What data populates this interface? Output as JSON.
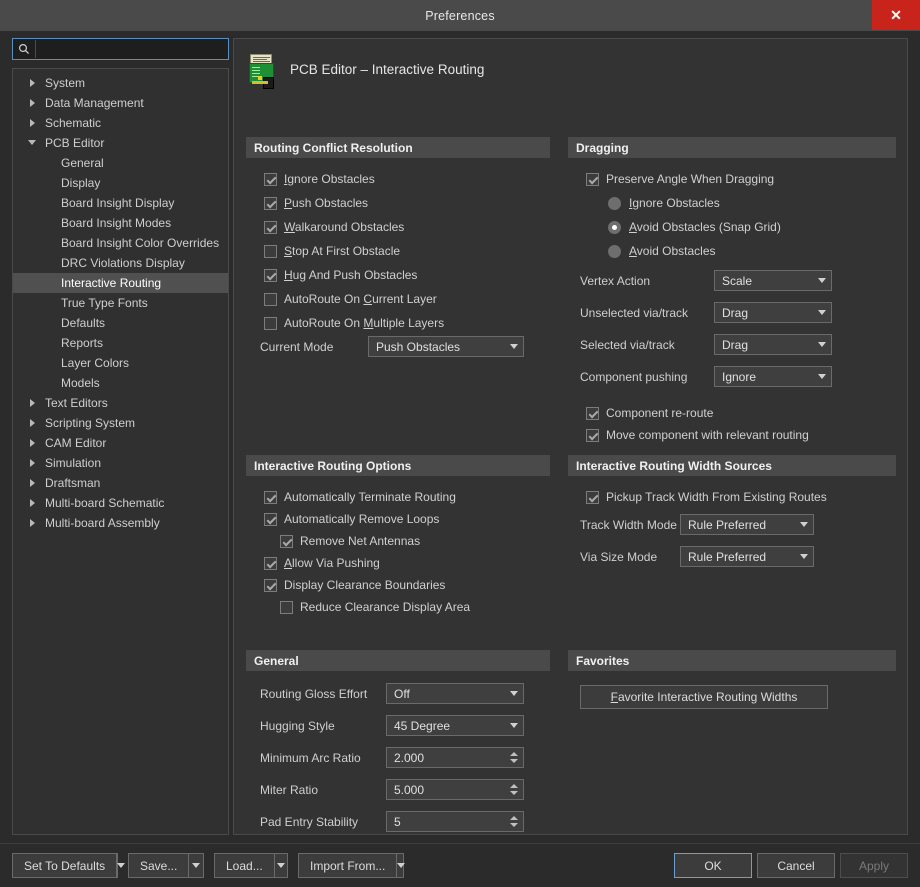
{
  "window": {
    "title": "Preferences",
    "close_icon": "close-icon"
  },
  "search": {
    "placeholder": "",
    "value": "",
    "icon": "search-icon"
  },
  "sidebar": {
    "items": [
      {
        "label": "System",
        "level": 0,
        "state": "collapsed",
        "selected": false
      },
      {
        "label": "Data Management",
        "level": 0,
        "state": "collapsed",
        "selected": false
      },
      {
        "label": "Schematic",
        "level": 0,
        "state": "collapsed",
        "selected": false
      },
      {
        "label": "PCB Editor",
        "level": 0,
        "state": "expanded",
        "selected": false
      },
      {
        "label": "General",
        "level": 1,
        "state": "leaf",
        "selected": false
      },
      {
        "label": "Display",
        "level": 1,
        "state": "leaf",
        "selected": false
      },
      {
        "label": "Board Insight Display",
        "level": 1,
        "state": "leaf",
        "selected": false
      },
      {
        "label": "Board Insight Modes",
        "level": 1,
        "state": "leaf",
        "selected": false
      },
      {
        "label": "Board Insight Color Overrides",
        "level": 1,
        "state": "leaf",
        "selected": false
      },
      {
        "label": "DRC Violations Display",
        "level": 1,
        "state": "leaf",
        "selected": false
      },
      {
        "label": "Interactive Routing",
        "level": 1,
        "state": "leaf",
        "selected": true
      },
      {
        "label": "True Type Fonts",
        "level": 1,
        "state": "leaf",
        "selected": false
      },
      {
        "label": "Defaults",
        "level": 1,
        "state": "leaf",
        "selected": false
      },
      {
        "label": "Reports",
        "level": 1,
        "state": "leaf",
        "selected": false
      },
      {
        "label": "Layer Colors",
        "level": 1,
        "state": "leaf",
        "selected": false
      },
      {
        "label": "Models",
        "level": 1,
        "state": "leaf",
        "selected": false
      },
      {
        "label": "Text Editors",
        "level": 0,
        "state": "collapsed",
        "selected": false
      },
      {
        "label": "Scripting System",
        "level": 0,
        "state": "collapsed",
        "selected": false
      },
      {
        "label": "CAM Editor",
        "level": 0,
        "state": "collapsed",
        "selected": false
      },
      {
        "label": "Simulation",
        "level": 0,
        "state": "collapsed",
        "selected": false
      },
      {
        "label": "Draftsman",
        "level": 0,
        "state": "collapsed",
        "selected": false
      },
      {
        "label": "Multi-board Schematic",
        "level": 0,
        "state": "collapsed",
        "selected": false
      },
      {
        "label": "Multi-board Assembly",
        "level": 0,
        "state": "collapsed",
        "selected": false
      }
    ]
  },
  "page": {
    "icon": "pcb-board-icon",
    "title": "PCB Editor – Interactive Routing"
  },
  "routing_conflict_resolution": {
    "header": "Routing Conflict Resolution",
    "checkboxes": [
      {
        "label": "Ignore Obstacles",
        "accel": "I",
        "checked": true
      },
      {
        "label": "Push Obstacles",
        "accel": "P",
        "checked": true
      },
      {
        "label": "Walkaround Obstacles",
        "accel": "W",
        "checked": true
      },
      {
        "label": "Stop At First Obstacle",
        "accel": "S",
        "checked": false
      },
      {
        "label": "Hug And Push Obstacles",
        "accel": "H",
        "checked": true
      },
      {
        "label": "AutoRoute On Current Layer",
        "accel": "C",
        "checked": false
      },
      {
        "label": "AutoRoute On Multiple Layers",
        "accel": "M",
        "checked": false
      }
    ],
    "current_mode": {
      "label": "Current Mode",
      "value": "Push Obstacles"
    }
  },
  "interactive_routing_options": {
    "header": "Interactive Routing Options",
    "checkboxes": [
      {
        "label": "Automatically Terminate Routing",
        "accel": "",
        "checked": true,
        "indent": 0
      },
      {
        "label": "Automatically Remove Loops",
        "accel": "",
        "checked": true,
        "indent": 0
      },
      {
        "label": "Remove Net Antennas",
        "accel": "",
        "checked": true,
        "indent": 1
      },
      {
        "label": "Allow Via Pushing",
        "accel": "A",
        "checked": true,
        "indent": 0
      },
      {
        "label": "Display Clearance Boundaries",
        "accel": "",
        "checked": true,
        "indent": 0
      },
      {
        "label": "Reduce Clearance Display Area",
        "accel": "",
        "checked": false,
        "indent": 1
      }
    ]
  },
  "general": {
    "header": "General",
    "fields": [
      {
        "label": "Routing Gloss Effort",
        "value": "Off",
        "type": "combo"
      },
      {
        "label": "Hugging Style",
        "value": "45 Degree",
        "type": "combo"
      },
      {
        "label": "Minimum Arc Ratio",
        "value": "2.000",
        "type": "spin"
      },
      {
        "label": "Miter Ratio",
        "value": "5.000",
        "type": "spin"
      },
      {
        "label": "Pad Entry Stability",
        "value": "5",
        "type": "spin"
      }
    ]
  },
  "dragging": {
    "header": "Dragging",
    "preserve_angle": {
      "label": "Preserve Angle When Dragging",
      "checked": true
    },
    "radios": [
      {
        "label": "Ignore Obstacles",
        "accel": "I",
        "selected": false
      },
      {
        "label": "Avoid Obstacles (Snap Grid)",
        "accel": "A",
        "selected": true
      },
      {
        "label": "Avoid Obstacles",
        "accel": "A",
        "selected": false
      }
    ],
    "fields": [
      {
        "label": "Vertex Action",
        "value": "Scale"
      },
      {
        "label": "Unselected via/track",
        "value": "Drag"
      },
      {
        "label": "Selected via/track",
        "value": "Drag"
      },
      {
        "label": "Component pushing",
        "value": "Ignore"
      }
    ],
    "checkboxes": [
      {
        "label": "Component re-route",
        "checked": true
      },
      {
        "label": "Move component with relevant routing",
        "checked": true
      }
    ]
  },
  "width_sources": {
    "header": "Interactive Routing Width Sources",
    "pickup": {
      "label": "Pickup Track Width From Existing Routes",
      "checked": true
    },
    "fields": [
      {
        "label": "Track Width Mode",
        "value": "Rule Preferred"
      },
      {
        "label": "Via Size Mode",
        "value": "Rule Preferred"
      }
    ]
  },
  "favorites": {
    "header": "Favorites",
    "button": {
      "label": "Favorite Interactive Routing Widths",
      "accel": "F"
    }
  },
  "footer": {
    "left_buttons": [
      {
        "label": "Set To Defaults",
        "has_dropdown": true
      },
      {
        "label": "Save...",
        "has_dropdown": true
      },
      {
        "label": "Load...",
        "has_dropdown": true
      },
      {
        "label": "Import From...",
        "has_dropdown": true
      }
    ],
    "right_buttons": [
      {
        "label": "OK",
        "style": "primary",
        "disabled": false
      },
      {
        "label": "Cancel",
        "style": "normal",
        "disabled": false
      },
      {
        "label": "Apply",
        "style": "normal",
        "disabled": true
      }
    ]
  },
  "colors": {
    "accent": "#5a8fc0",
    "close": "#c8241c",
    "panel_header": "#4a4a4a",
    "background": "#2b2b2b"
  }
}
